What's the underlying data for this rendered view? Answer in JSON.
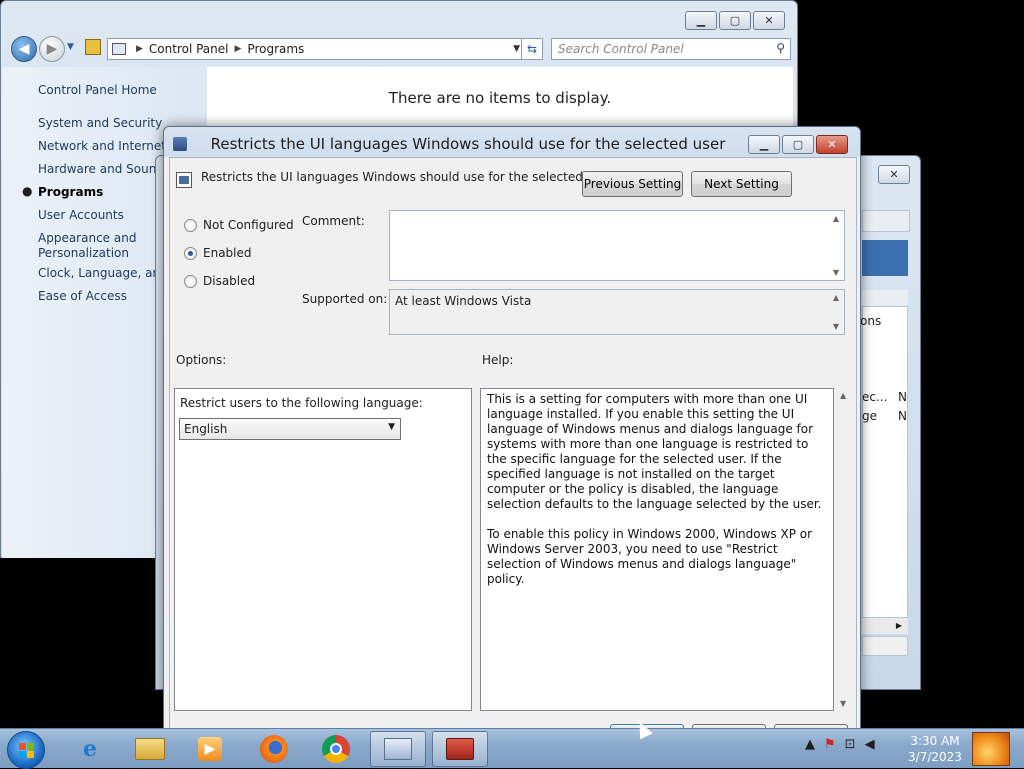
{
  "control_panel": {
    "breadcrumb": [
      "Control Panel",
      "Programs"
    ],
    "search_placeholder": "Search Control Panel",
    "sidebar": [
      "Control Panel Home",
      "System and Security",
      "Network and Internet",
      "Hardware and Sound",
      "Programs",
      "User Accounts",
      "Appearance and",
      "Personalization",
      "Clock, Language, and",
      "Ease of Access"
    ],
    "active_item": "Programs",
    "empty_message": "There are no items to display."
  },
  "background_window": {
    "fragments": [
      "ons",
      "ec...",
      "N",
      "ge",
      "N"
    ]
  },
  "dialog": {
    "title": "Restricts the UI languages Windows should use for the selected user",
    "setting_name": "Restricts the UI languages Windows should use for the selected user",
    "previous_label": "Previous Setting",
    "next_label": "Next Setting",
    "states": [
      "Not Configured",
      "Enabled",
      "Disabled"
    ],
    "selected_state": "Enabled",
    "comment_label": "Comment:",
    "comment_value": "",
    "supported_label": "Supported on:",
    "supported_value": "At least Windows Vista",
    "options_label": "Options:",
    "help_label": "Help:",
    "option_prompt": "Restrict users to the following language:",
    "language_value": "English",
    "help_paragraphs": [
      "This is a setting for computers with more than one UI language installed. If you enable this setting the UI language of Windows menus and dialogs language for systems with more than one language is restricted to the specific language for the selected user. If the specified language is not installed on the target computer or the policy is disabled, the language selection defaults to the language selected by the user.",
      "To enable this policy in Windows 2000, Windows XP or Windows Server 2003, you need to use \"Restrict selection of Windows menus and dialogs language\" policy."
    ]
  },
  "taskbar": {
    "apps": [
      "internet-explorer-icon",
      "file-explorer-icon",
      "media-player-icon",
      "firefox-icon",
      "chrome-icon",
      "control-panel-icon",
      "group-policy-icon"
    ],
    "time": "3:30 AM",
    "date": "3/7/2023"
  },
  "colors": {
    "window_frame": "#c9d9ea",
    "taskbar": "#8aa9cb",
    "link": "#1e395b"
  }
}
